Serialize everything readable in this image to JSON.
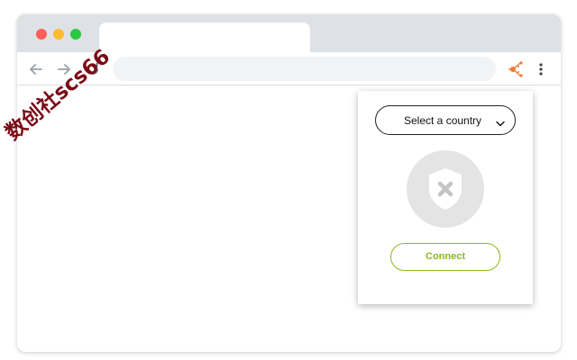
{
  "browser": {
    "toolbar": {
      "address_value": ""
    }
  },
  "watermark": {
    "text": "数创社scs66"
  },
  "popup": {
    "country_select": {
      "label": "Select a country"
    },
    "status": {
      "icon": "shield-x-icon",
      "state": "disconnected"
    },
    "connect_button": {
      "label": "Connect"
    }
  },
  "colors": {
    "accent": "#8cb81a",
    "window_close": "#ff5f57",
    "window_minimize": "#febc2e",
    "window_maximize": "#28c840",
    "extension_icon": "#f07a38",
    "watermark": "#7a0a16"
  }
}
